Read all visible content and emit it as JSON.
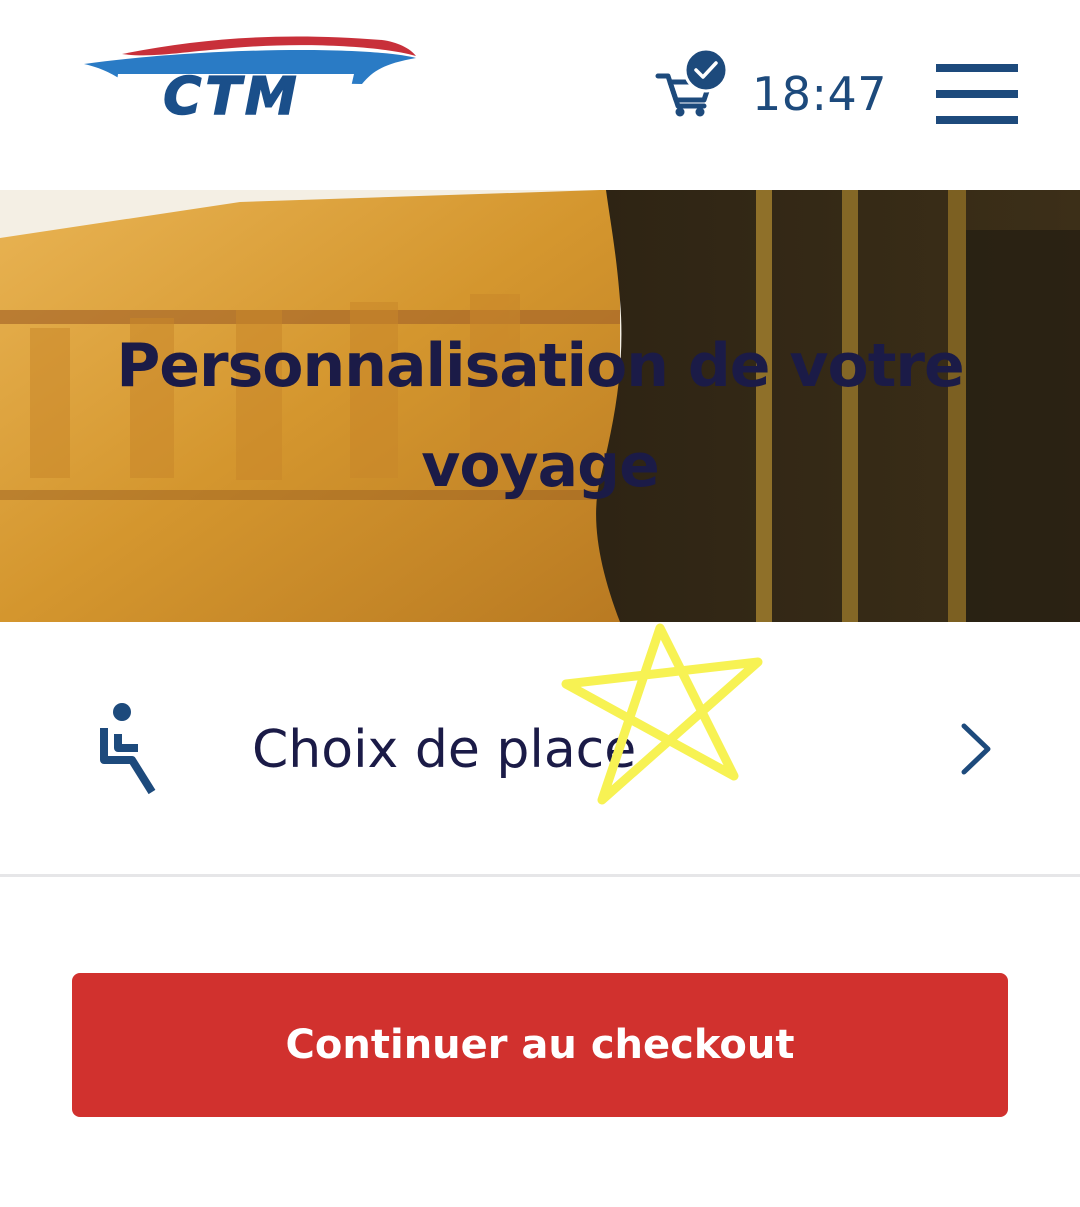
{
  "header": {
    "logo_text": "CTM",
    "cart_icon": "cart-icon",
    "cart_badge_icon": "check-icon",
    "time": "18:47",
    "menu_icon": "hamburger-menu-icon"
  },
  "hero": {
    "title": "Personnalisation de votre voyage"
  },
  "options": [
    {
      "icon": "seat-icon",
      "label": "Choix de place",
      "chevron_icon": "chevron-right-icon"
    }
  ],
  "annotation": {
    "icon": "star-icon",
    "color": "#f7f253"
  },
  "checkout": {
    "label": "Continuer au checkout"
  },
  "colors": {
    "brand_blue": "#1d4a7c",
    "logo_blue": "#2a7bc5",
    "logo_red": "#d1312e",
    "title_navy": "#1b1b47",
    "button_red": "#d1312e"
  }
}
